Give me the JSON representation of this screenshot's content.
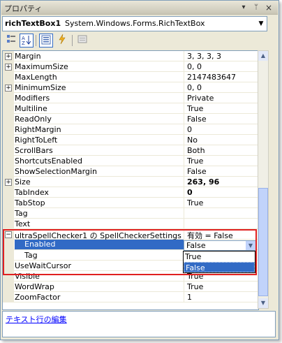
{
  "window": {
    "title": "プロパティ",
    "menu_glyph": "▾",
    "pin_glyph": "ᛘ",
    "close_glyph": "×"
  },
  "object_selector": {
    "name": "richTextBox1",
    "type": "System.Windows.Forms.RichTextBox"
  },
  "toolbar": {
    "categorized": "categorized-icon",
    "alphabetical": "alphabetical-icon",
    "properties": "properties-icon",
    "events": "events-icon",
    "pages": "property-pages-icon"
  },
  "properties": [
    {
      "name": "Margin",
      "value": "3, 3, 3, 3",
      "expandable": true
    },
    {
      "name": "MaximumSize",
      "value": "0, 0",
      "expandable": true
    },
    {
      "name": "MaxLength",
      "value": "2147483647"
    },
    {
      "name": "MinimumSize",
      "value": "0, 0",
      "expandable": true
    },
    {
      "name": "Modifiers",
      "value": "Private"
    },
    {
      "name": "Multiline",
      "value": "True"
    },
    {
      "name": "ReadOnly",
      "value": "False"
    },
    {
      "name": "RightMargin",
      "value": "0"
    },
    {
      "name": "RightToLeft",
      "value": "No"
    },
    {
      "name": "ScrollBars",
      "value": "Both"
    },
    {
      "name": "ShortcutsEnabled",
      "value": "True"
    },
    {
      "name": "ShowSelectionMargin",
      "value": "False"
    },
    {
      "name": "Size",
      "value": "263, 96",
      "expandable": true,
      "bold": true
    },
    {
      "name": "TabIndex",
      "value": "0",
      "bold": true
    },
    {
      "name": "TabStop",
      "value": "True"
    },
    {
      "name": "Tag",
      "value": ""
    },
    {
      "name": "Text",
      "value": ""
    },
    {
      "name": "ultraSpellChecker1 の SpellCheckerSettings",
      "value": "有効 = False",
      "collapsible": true
    },
    {
      "name": "Enabled",
      "value": "False",
      "selected": true,
      "sub": true
    },
    {
      "name": "Tag",
      "value": "",
      "sub": true
    },
    {
      "name": "UseWaitCursor",
      "value": ""
    },
    {
      "name": "Visible",
      "value": "True"
    },
    {
      "name": "WordWrap",
      "value": "True"
    },
    {
      "name": "ZoomFactor",
      "value": "1"
    }
  ],
  "dropdown": {
    "value": "False",
    "options": [
      "True",
      "False"
    ],
    "highlighted": "False"
  },
  "commands": {
    "link": "テキスト行の編集"
  }
}
